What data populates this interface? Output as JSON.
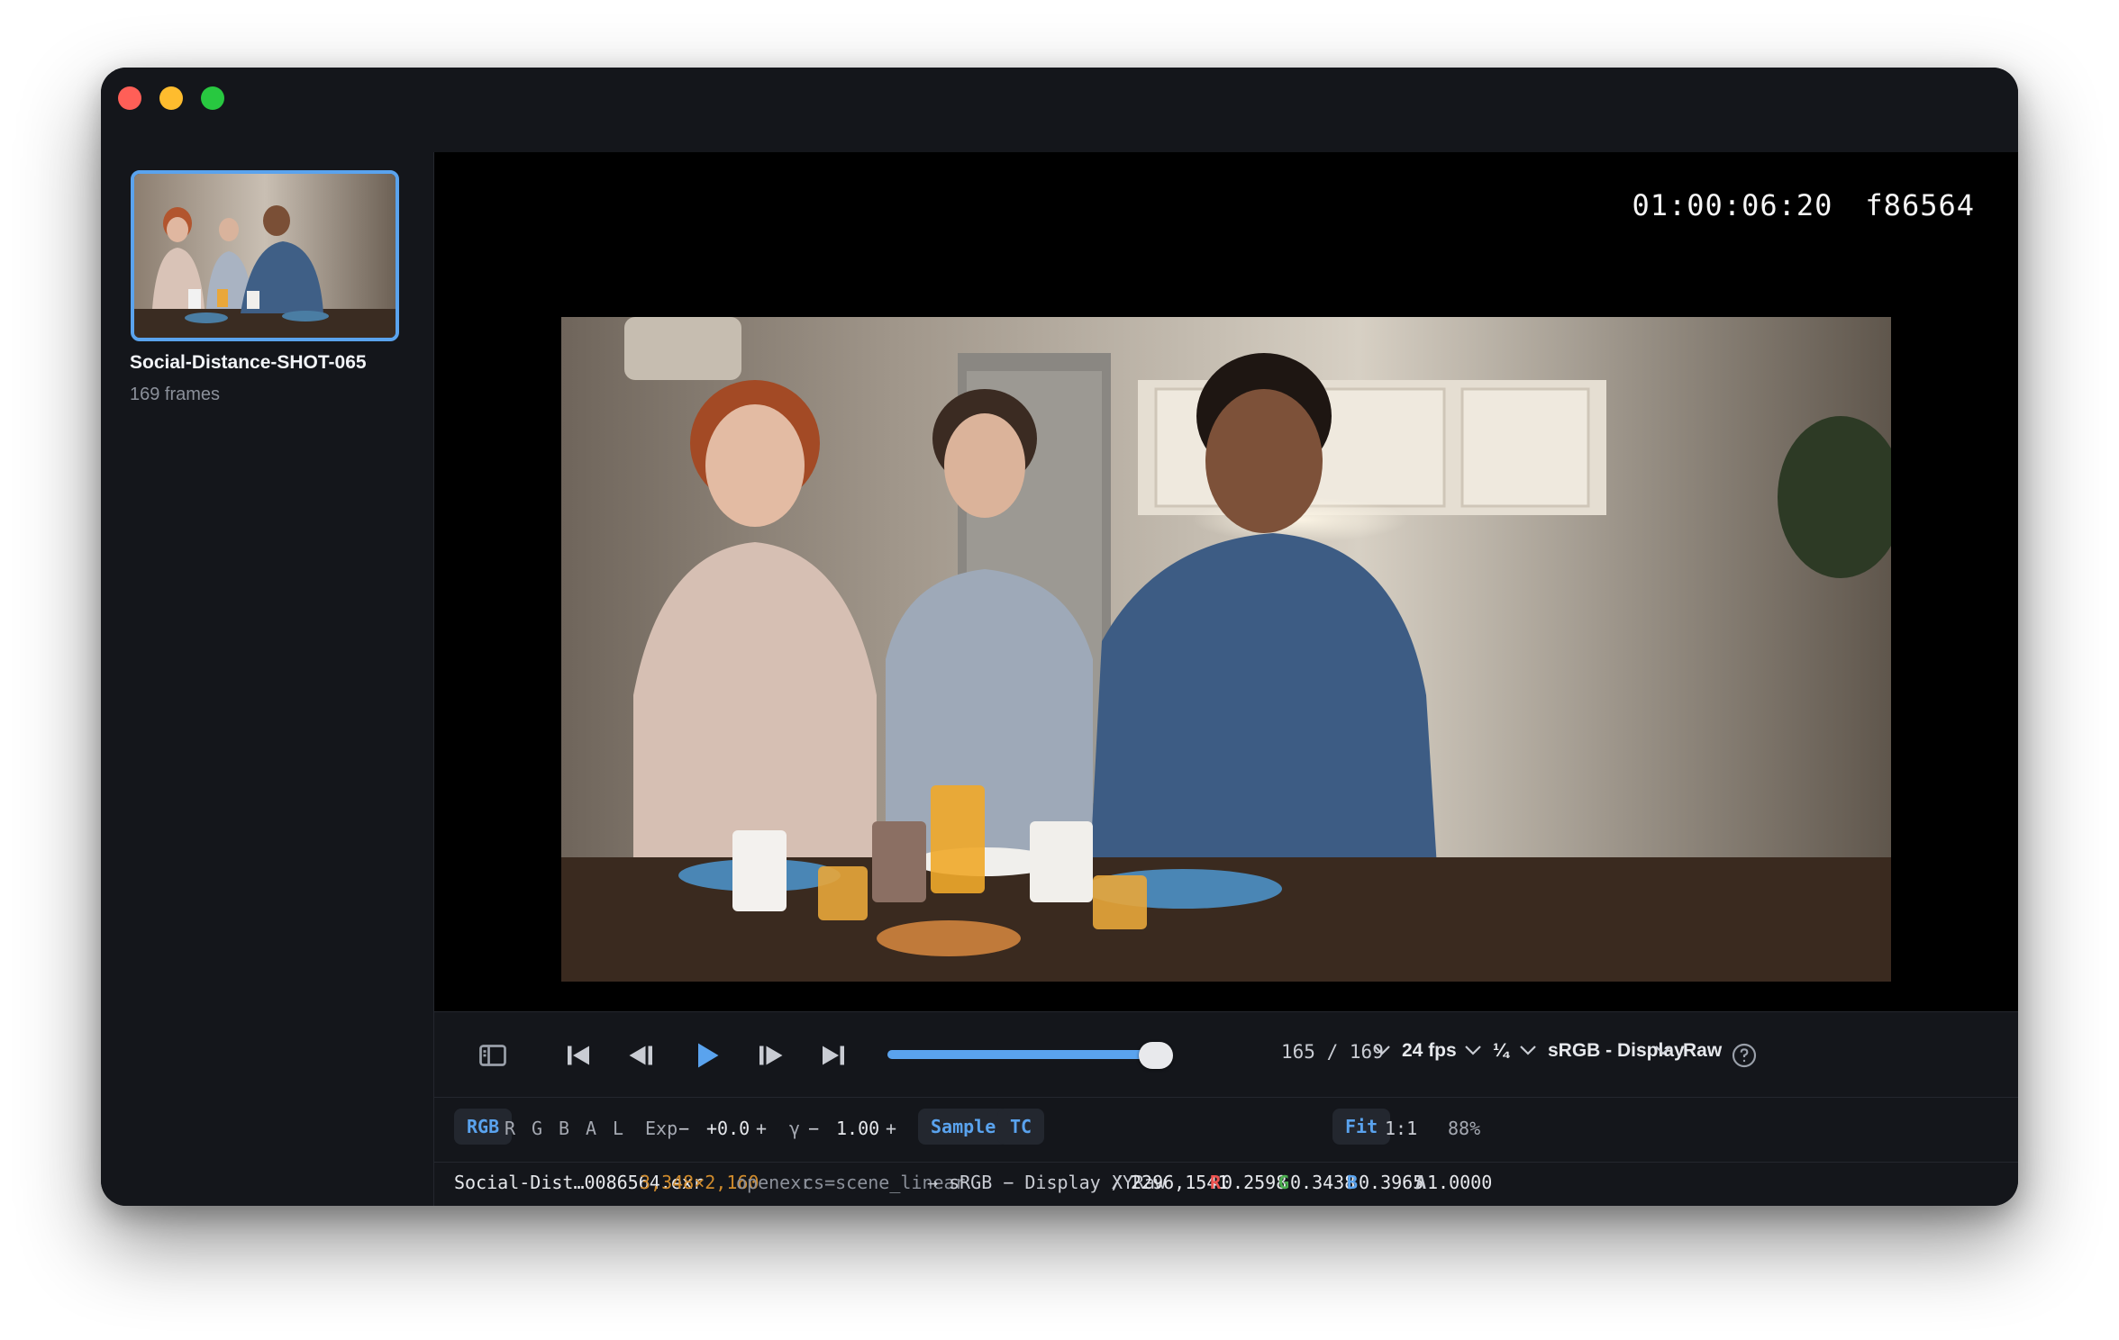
{
  "window": {
    "controls": [
      "close",
      "minimize",
      "zoom"
    ]
  },
  "sidebar": {
    "clip": {
      "name": "Social-Distance-SHOT-065",
      "frames": "169 frames",
      "selected": true
    }
  },
  "viewer": {
    "timecode": "01:00:06:20",
    "frame_id": "f86564"
  },
  "transport": {
    "current_frame": "165",
    "separator": "/",
    "total_frames": "169",
    "progress": 0.976,
    "fps": "24 fps",
    "resolution_scale": "¼",
    "display": "sRGB - Display",
    "view": "Raw",
    "icons": [
      "sidebar-toggle-icon",
      "skip-to-start-icon",
      "step-back-icon",
      "play-icon",
      "step-forward-icon",
      "skip-to-end-icon",
      "help-icon"
    ]
  },
  "channels": {
    "items": [
      "RGB",
      "R",
      "G",
      "B",
      "A",
      "L"
    ],
    "active": "RGB",
    "exposure_label": "Exp",
    "exposure_minus": "−",
    "exposure_value": "+0.0",
    "exposure_plus": "+",
    "gamma_label": "γ",
    "gamma_minus": "−",
    "gamma_value": "1.00",
    "gamma_plus": "+",
    "sample_label": "Sample",
    "tc_label": "TC",
    "fit_label": "Fit",
    "one_to_one_label": "1:1",
    "zoom": "88%"
  },
  "status": {
    "filename": "Social-Dist…0086564.exr",
    "dimensions": "3,348×2,160",
    "format": "openexr",
    "colorspace": "cs=scene_linear",
    "pipeline": "→ sRGB − Display / Raw",
    "xy_label": "XY",
    "xy_value": "2296,1541",
    "r_label": "R",
    "r_value": "0.2598",
    "g_label": "G",
    "g_value": "0.3438",
    "b_label": "B",
    "b_value": "0.3965",
    "a_label": "A",
    "a_value": "1.0000",
    "colors": {
      "accent": "#5aa3ee",
      "dimensions": "#d08b2c",
      "red": "#ef5350",
      "green": "#4caf50",
      "blue": "#5aa3ee"
    }
  }
}
